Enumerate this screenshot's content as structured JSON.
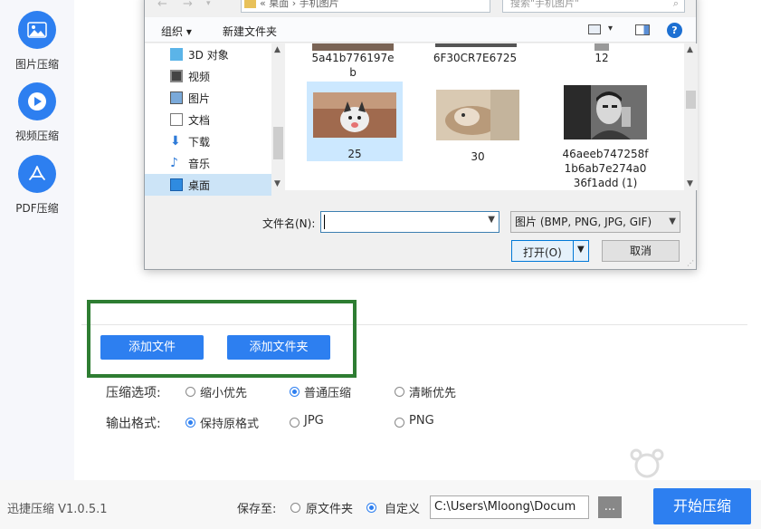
{
  "colors": {
    "accent": "#2d7ff0",
    "highlight_border": "#2e7d32",
    "selection": "#cce4f7"
  },
  "sidebar": {
    "items": [
      {
        "label": "图片压缩",
        "icon": "image-icon"
      },
      {
        "label": "视频压缩",
        "icon": "play-icon"
      },
      {
        "label": "PDF压缩",
        "icon": "pdf-icon"
      }
    ]
  },
  "dialog": {
    "address": "« 桌面 › 手机图片",
    "search_placeholder": "搜索\"手机图片\"",
    "toolbar": {
      "organize": "组织 ▾",
      "new_folder": "新建文件夹",
      "help": "?"
    },
    "nav_items": [
      {
        "label": "3D 对象",
        "icon": "cube-icon"
      },
      {
        "label": "视频",
        "icon": "video-icon"
      },
      {
        "label": "图片",
        "icon": "picture-icon"
      },
      {
        "label": "文档",
        "icon": "document-icon"
      },
      {
        "label": "下载",
        "icon": "download-icon"
      },
      {
        "label": "音乐",
        "icon": "music-icon"
      },
      {
        "label": "桌面",
        "icon": "desktop-icon",
        "selected": true
      }
    ],
    "files_top": [
      {
        "name_line1": "5a41b776197e",
        "name_line2": "b"
      },
      {
        "name_line1": "6F30CR7E6725",
        "name_line2": ""
      },
      {
        "name_line1": "12",
        "name_line2": ""
      }
    ],
    "files": [
      {
        "name_line1": "25",
        "name_line2": "",
        "name_line3": "",
        "selected": true
      },
      {
        "name_line1": "30",
        "name_line2": "",
        "name_line3": ""
      },
      {
        "name_line1": "46aeeb747258f",
        "name_line2": "1b6ab7e274a0",
        "name_line3": "36f1add (1)"
      }
    ],
    "filename_label": "文件名(N):",
    "filename_value": "",
    "filetype": "图片 (BMP, PNG, JPG, GIF)",
    "open_label": "打开(O)",
    "cancel_label": "取消"
  },
  "actions": {
    "add_file": "添加文件",
    "add_folder": "添加文件夹"
  },
  "compress_options": {
    "label": "压缩选项:",
    "options": [
      {
        "label": "缩小优先",
        "checked": false
      },
      {
        "label": "普通压缩",
        "checked": true
      },
      {
        "label": "清晰优先",
        "checked": false
      }
    ]
  },
  "output_format": {
    "label": "输出格式:",
    "options": [
      {
        "label": "保持原格式",
        "checked": true
      },
      {
        "label": "JPG",
        "checked": false
      },
      {
        "label": "PNG",
        "checked": false
      }
    ]
  },
  "footer": {
    "version": "迅捷压缩 V1.0.5.1",
    "save_to_label": "保存至:",
    "save_options": [
      {
        "label": "原文件夹",
        "checked": false
      },
      {
        "label": "自定义",
        "checked": true
      }
    ],
    "path": "C:\\Users\\Mloong\\Docum",
    "browse_label": "...",
    "start_label": "开始压缩"
  }
}
